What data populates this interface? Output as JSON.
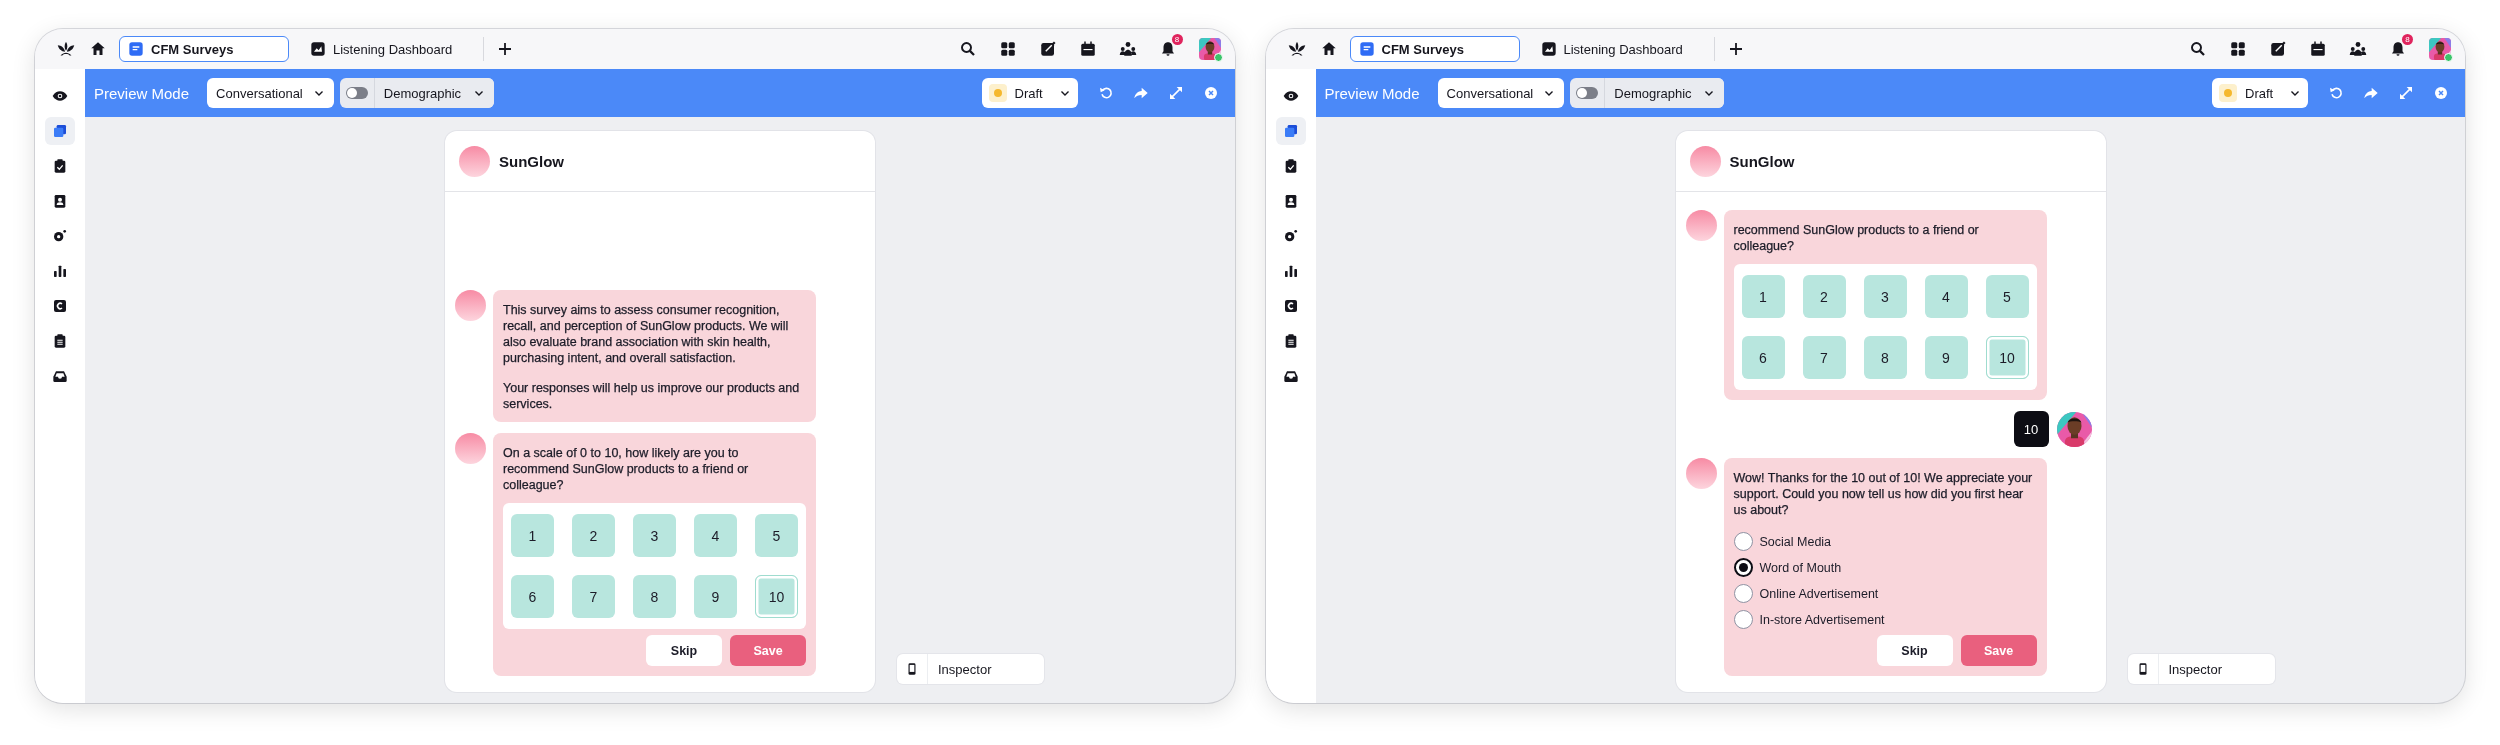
{
  "windows": [
    {
      "tabs": [
        {
          "label": "CFM Surveys",
          "selected": true
        },
        {
          "label": "Listening Dashboard",
          "selected": false
        }
      ],
      "notification_count": "8",
      "toolbar": {
        "title": "Preview Mode",
        "mode": "Conversational",
        "toggle": {
          "label": "Demographic",
          "on": false
        },
        "status": "Draft"
      },
      "sidebar": [
        {
          "selected": false
        },
        {
          "selected": true
        },
        {
          "selected": false
        },
        {
          "selected": false
        },
        {
          "selected": false
        },
        {
          "selected": false
        },
        {
          "selected": false
        },
        {
          "selected": false
        },
        {
          "selected": false
        }
      ],
      "chat": {
        "title": "SunGlow",
        "messages": [
          {
            "kind": "text",
            "paragraphs": [
              "This survey aims to assess consumer recognition, recall, and perception of SunGlow products. We will also evaluate brand association with skin health, purchasing intent, and overall satisfaction.",
              "Your responses will help us improve our products and services."
            ]
          },
          {
            "kind": "rating",
            "question": "On a scale of 0 to 10, how likely are you to recommend SunGlow products to a friend or colleague?",
            "options": [
              {
                "label": "1",
                "selected": false
              },
              {
                "label": "2",
                "selected": false
              },
              {
                "label": "3",
                "selected": false
              },
              {
                "label": "4",
                "selected": false
              },
              {
                "label": "5",
                "selected": false
              },
              {
                "label": "6",
                "selected": false
              },
              {
                "label": "7",
                "selected": false
              },
              {
                "label": "8",
                "selected": false
              },
              {
                "label": "9",
                "selected": false
              },
              {
                "label": "10",
                "selected": true
              }
            ],
            "buttons": [
              {
                "label": "Skip",
                "kind": "secondary"
              },
              {
                "label": "Save",
                "kind": "primary"
              }
            ]
          }
        ]
      },
      "inspector": "Inspector"
    },
    {
      "tabs": [
        {
          "label": "CFM Surveys",
          "selected": true
        },
        {
          "label": "Listening Dashboard",
          "selected": false
        }
      ],
      "notification_count": "8",
      "toolbar": {
        "title": "Preview Mode",
        "mode": "Conversational",
        "toggle": {
          "label": "Demographic",
          "on": false
        },
        "status": "Draft"
      },
      "sidebar": [
        {
          "selected": false
        },
        {
          "selected": true
        },
        {
          "selected": false
        },
        {
          "selected": false
        },
        {
          "selected": false
        },
        {
          "selected": false
        },
        {
          "selected": false
        },
        {
          "selected": false
        },
        {
          "selected": false
        }
      ],
      "chat": {
        "title": "SunGlow",
        "messages": [
          {
            "kind": "rating",
            "question": "recommend SunGlow products to a friend or colleague?",
            "options": [
              {
                "label": "1",
                "selected": false
              },
              {
                "label": "2",
                "selected": false
              },
              {
                "label": "3",
                "selected": false
              },
              {
                "label": "4",
                "selected": false
              },
              {
                "label": "5",
                "selected": false
              },
              {
                "label": "6",
                "selected": false
              },
              {
                "label": "7",
                "selected": false
              },
              {
                "label": "8",
                "selected": false
              },
              {
                "label": "9",
                "selected": false
              },
              {
                "label": "10",
                "selected": true
              }
            ]
          },
          {
            "kind": "reply",
            "text": "10"
          },
          {
            "kind": "choice",
            "question": "Wow! Thanks for the 10 out of 10! We appreciate your support. Could you now tell us how did you first hear us about?",
            "options": [
              {
                "label": "Social Media",
                "selected": false
              },
              {
                "label": "Word of Mouth",
                "selected": true
              },
              {
                "label": "Online Advertisement",
                "selected": false
              },
              {
                "label": "In-store Advertisement",
                "selected": false
              }
            ],
            "buttons": [
              {
                "label": "Skip",
                "kind": "secondary"
              },
              {
                "label": "Save",
                "kind": "primary"
              }
            ]
          }
        ]
      },
      "inspector": "Inspector"
    }
  ]
}
